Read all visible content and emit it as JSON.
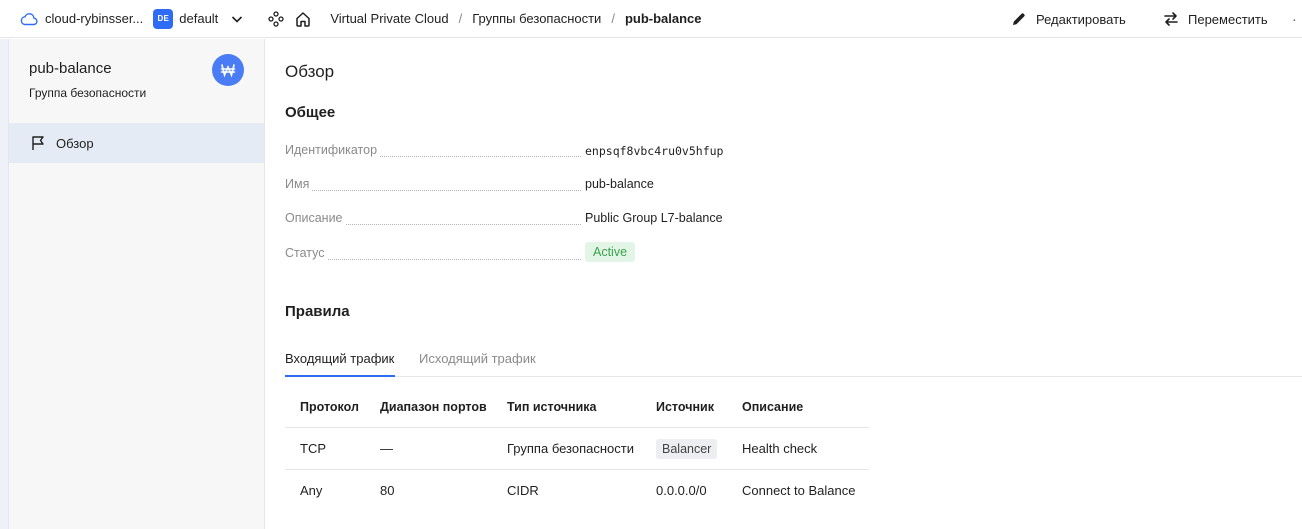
{
  "topbar": {
    "cloud_name": "cloud-rybinsser...",
    "folder_badge": "DE",
    "folder_name": "default",
    "breadcrumbs": [
      "Virtual Private Cloud",
      "Группы безопасности",
      "pub-balance"
    ],
    "separator": "/",
    "edit_label": "Редактировать",
    "move_label": "Переместить",
    "more": "·"
  },
  "sidebar": {
    "resource_title": "pub-balance",
    "resource_subtitle": "Группа безопасности",
    "items": [
      {
        "label": "Обзор",
        "icon": "flag-icon",
        "active": true
      }
    ]
  },
  "main": {
    "page_title": "Обзор",
    "general": {
      "heading": "Общее",
      "props": [
        {
          "key": "Идентификатор",
          "value": "enpsqf8vbc4ru0v5hfup"
        },
        {
          "key": "Имя",
          "value": "pub-balance"
        },
        {
          "key": "Описание",
          "value": "Public Group L7-balance"
        },
        {
          "key": "Статус",
          "value": "Active"
        }
      ]
    },
    "rules": {
      "heading": "Правила",
      "tabs": [
        "Входящий трафик",
        "Исходящий трафик"
      ],
      "active_tab": "Входящий трафик",
      "columns": [
        "Протокол",
        "Диапазон портов",
        "Тип источника",
        "Источник",
        "Описание"
      ],
      "rows": [
        [
          "TCP",
          "—",
          "Группа безопасности",
          "Balancer",
          "Health check"
        ],
        [
          "Any",
          "80",
          "CIDR",
          "0.0.0.0/0",
          "Connect to Balance"
        ]
      ]
    }
  },
  "colors": {
    "accent": "#2f6cf6",
    "status_active_bg": "#e3f5e6",
    "status_active_text": "#3aa34b",
    "sidebar_active_bg": "#e5ebf5"
  }
}
